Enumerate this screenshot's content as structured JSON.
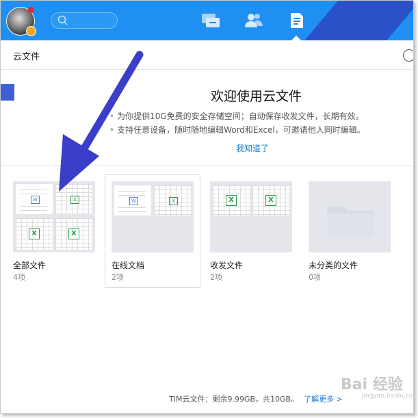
{
  "header": {
    "title": "云文件"
  },
  "welcome": {
    "title": "欢迎使用云文件",
    "bullets": [
      "为你提供10G免费的安全存储空间；自动保存收发文件，长期有效。",
      "支持任意设备，随时随地编辑Word和Excel，可邀请他人同时编辑。"
    ],
    "got_it": "我知道了"
  },
  "folders": [
    {
      "name": "全部文件",
      "count": "4项"
    },
    {
      "name": "在线文档",
      "count": "2项"
    },
    {
      "name": "收发文件",
      "count": "2项"
    },
    {
      "name": "未分类的文件",
      "count": "0项"
    }
  ],
  "footer": {
    "storage": "TIM云文件：剩余9.99GB，共10GB。",
    "more": "了解更多 >"
  },
  "watermark": {
    "text": "Bai 经验",
    "sub": "jingyan.baidu.com"
  },
  "colors": {
    "topbar": "#1f8ff2",
    "accent_corner": "#2a52c8",
    "link": "#1a7ed8",
    "arrow": "#3a3ec8"
  },
  "icons": {
    "nav": [
      "chat-icon",
      "contacts-icon",
      "files-icon"
    ],
    "search": "search-icon"
  }
}
